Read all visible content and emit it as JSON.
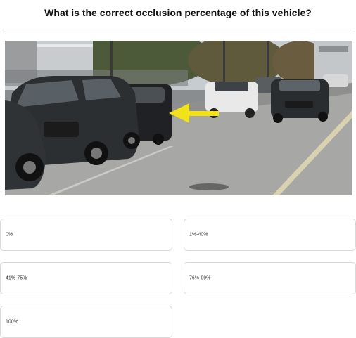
{
  "question": "What is the correct occlusion percentage of this vehicle?",
  "options": [
    {
      "label": "0%"
    },
    {
      "label": "1%-40%"
    },
    {
      "label": "41%-75%"
    },
    {
      "label": "76%-99%"
    },
    {
      "label": "100%"
    }
  ],
  "colors": {
    "arrow": "#f2e21a",
    "divider": "#9a9a9a",
    "option_border": "#d9d9d9"
  },
  "image": {
    "content": "street-photo-parked-cars",
    "marker_icon": "arrow-left-icon"
  }
}
